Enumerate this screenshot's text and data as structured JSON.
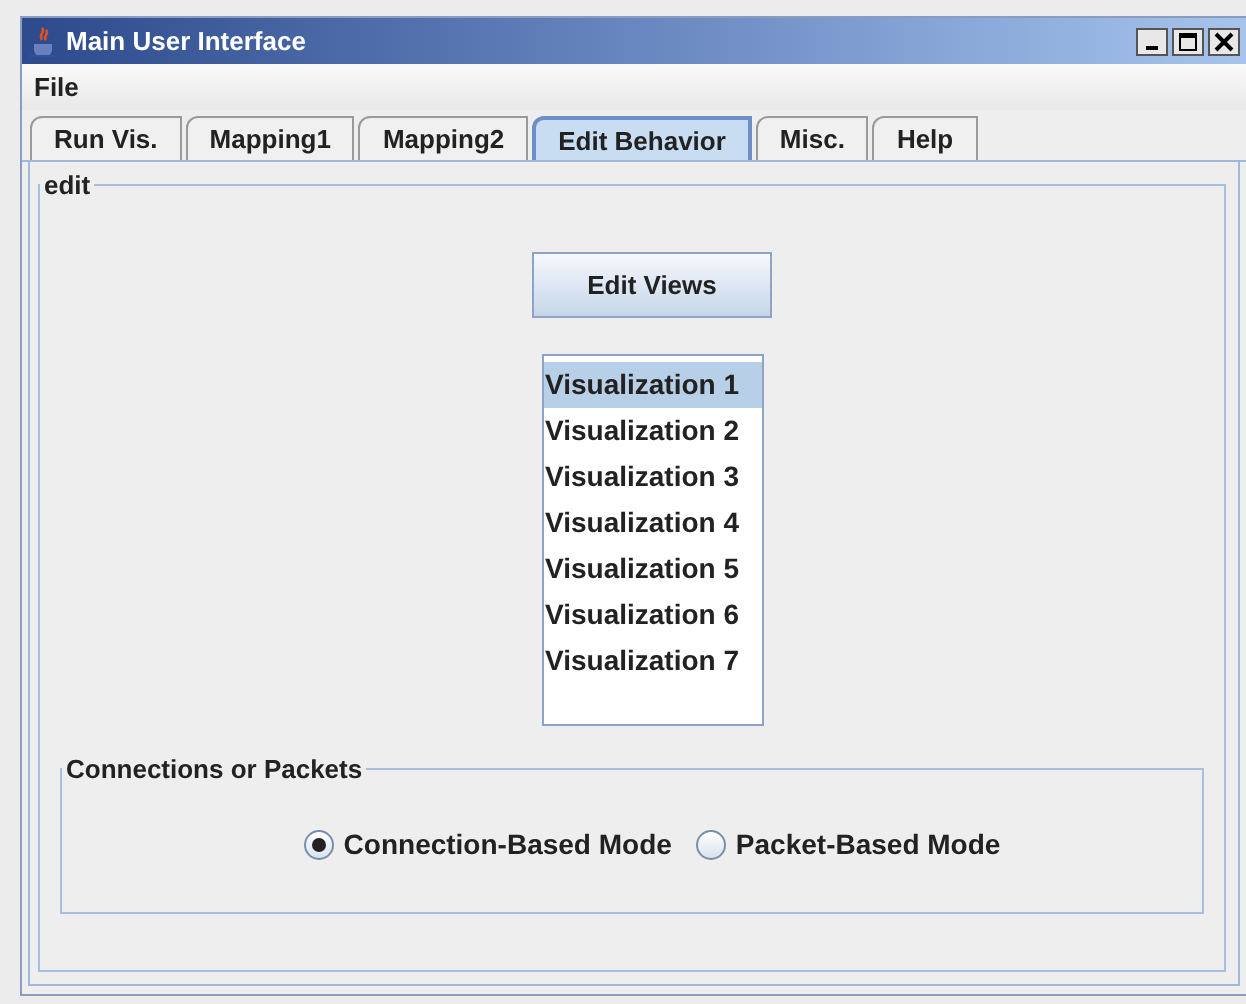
{
  "window": {
    "title": "Main User Interface"
  },
  "menu": [
    "File"
  ],
  "tabs": [
    {
      "label": "Run Vis.",
      "selected": false
    },
    {
      "label": "Mapping1",
      "selected": false
    },
    {
      "label": "Mapping2",
      "selected": false
    },
    {
      "label": "Edit Behavior",
      "selected": true
    },
    {
      "label": "Misc.",
      "selected": false
    },
    {
      "label": "Help",
      "selected": false
    }
  ],
  "panel": {
    "title": "edit",
    "button": "Edit Views",
    "views": [
      {
        "label": "Visualization 1",
        "selected": true
      },
      {
        "label": "Visualization 2",
        "selected": false
      },
      {
        "label": "Visualization 3",
        "selected": false
      },
      {
        "label": "Visualization 4",
        "selected": false
      },
      {
        "label": "Visualization 5",
        "selected": false
      },
      {
        "label": "Visualization 6",
        "selected": false
      },
      {
        "label": "Visualization 7",
        "selected": false
      }
    ]
  },
  "group": {
    "title": "Connections or Packets",
    "options": [
      {
        "label": "Connection-Based Mode",
        "selected": true
      },
      {
        "label": "Packet-Based Mode",
        "selected": false
      }
    ]
  }
}
